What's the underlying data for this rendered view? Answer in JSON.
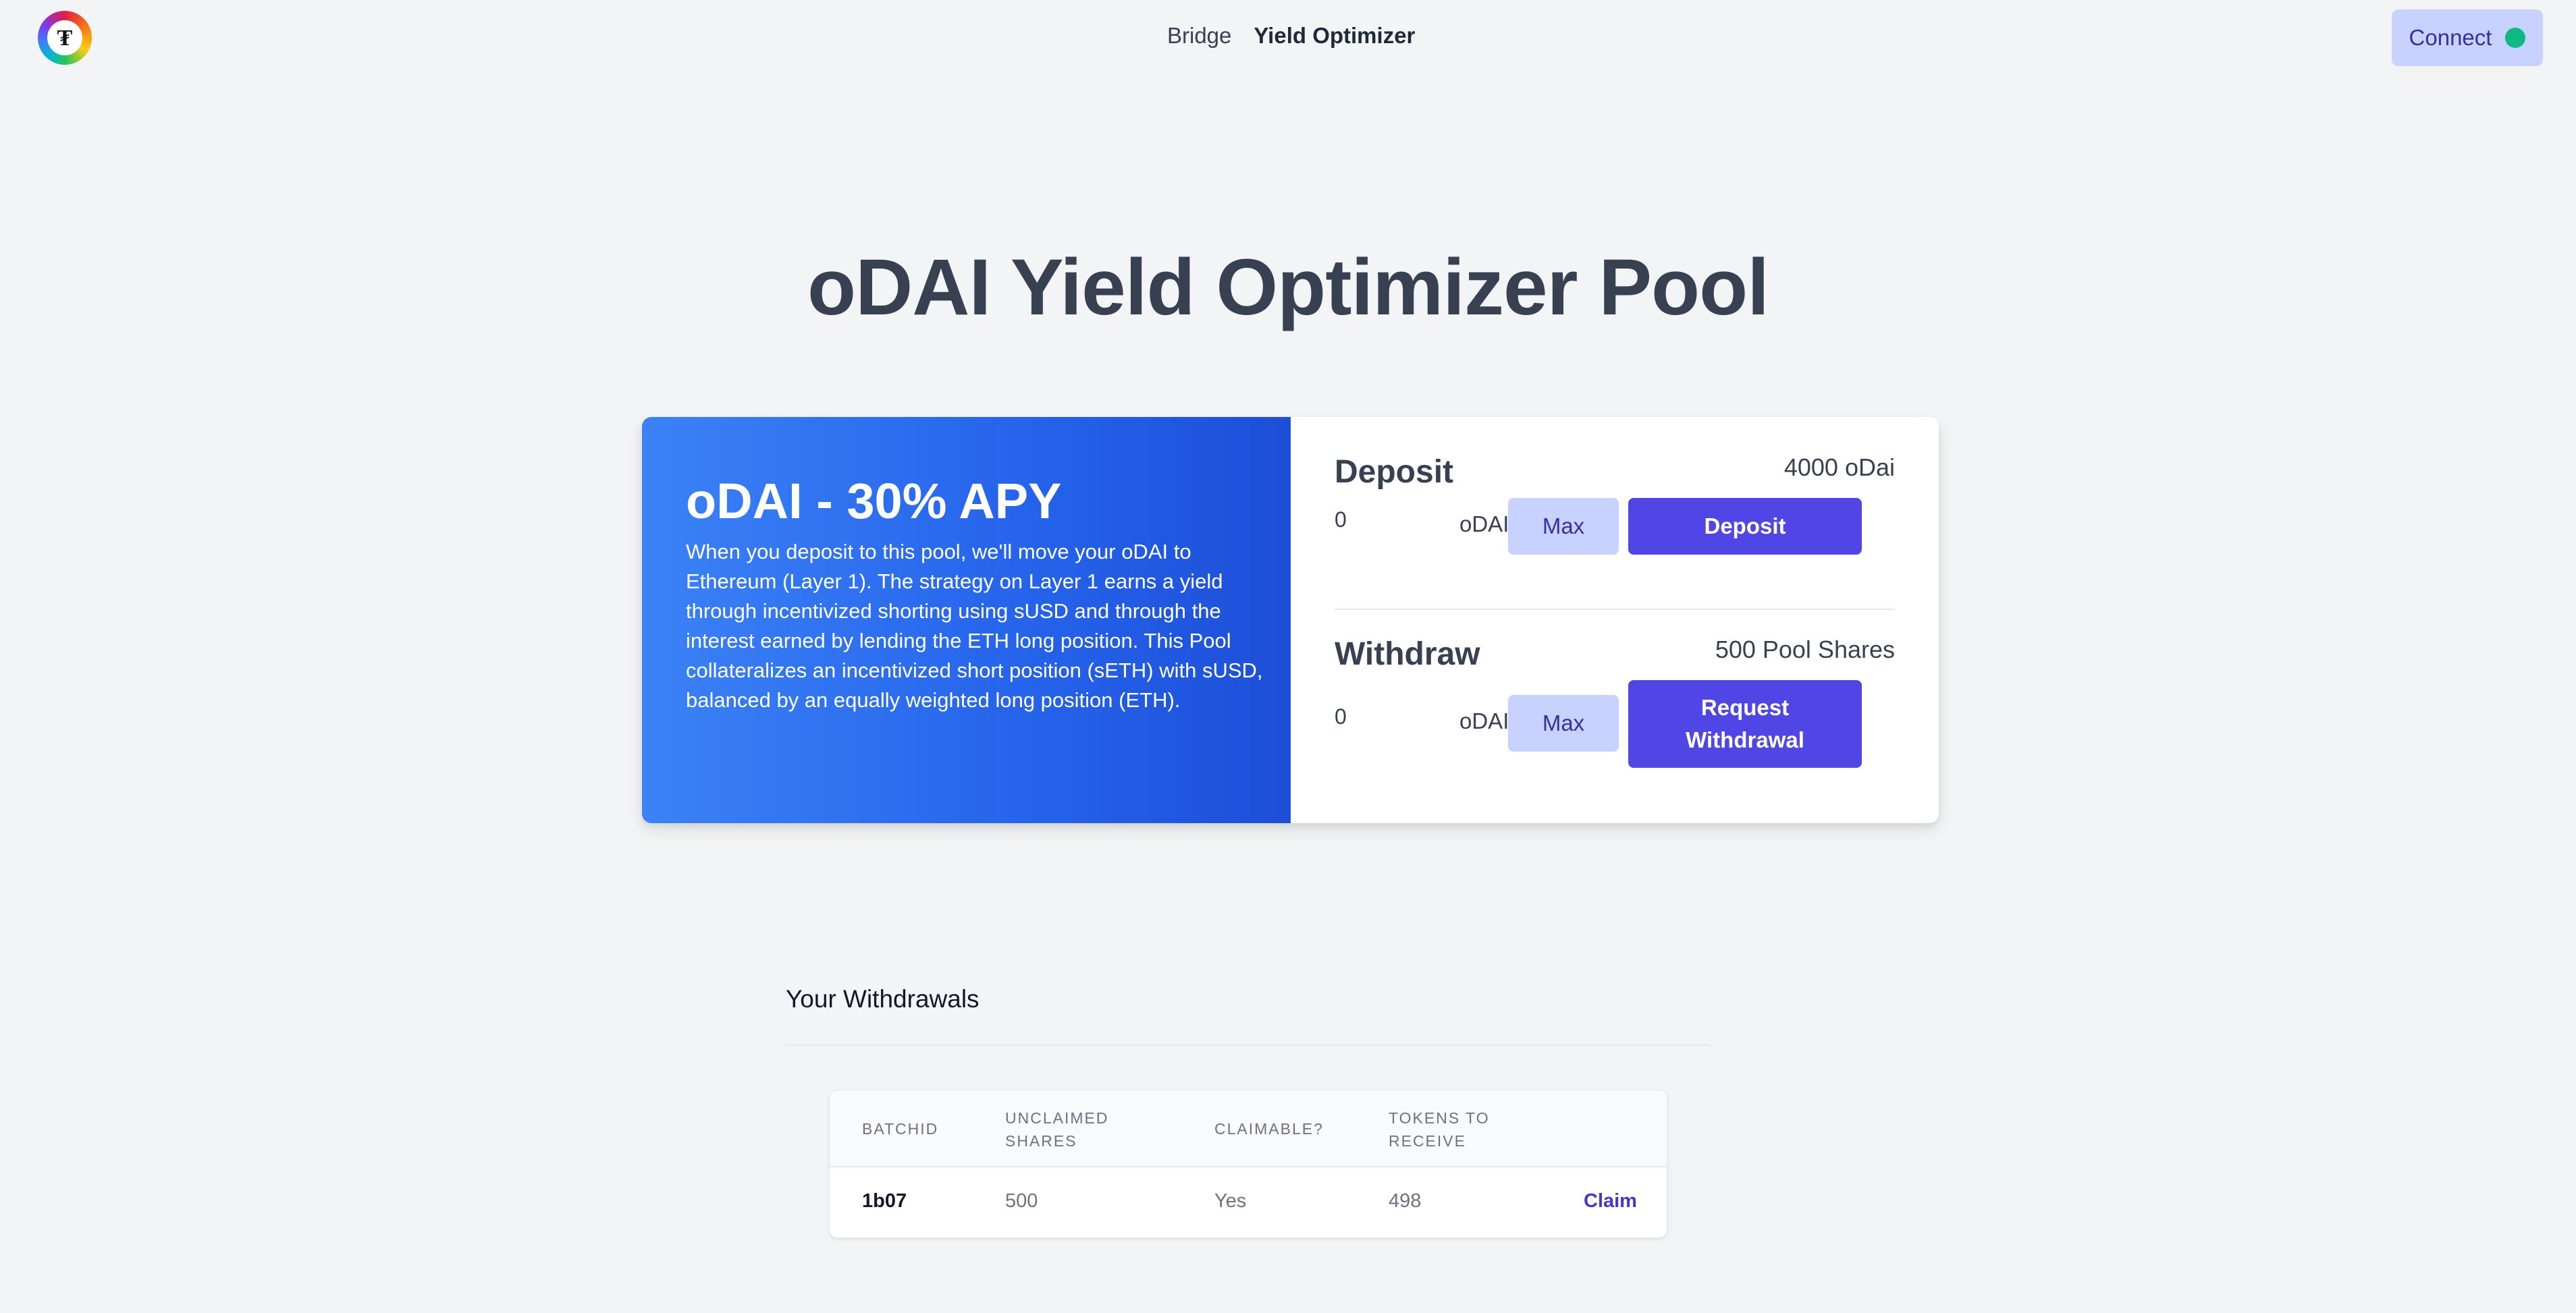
{
  "header": {
    "logo_glyph": "₮",
    "nav": [
      {
        "label": "Bridge",
        "active": false
      },
      {
        "label": "Yield Optimizer",
        "active": true
      }
    ],
    "connect_label": "Connect",
    "connect_status_color": "#10b981"
  },
  "page_title": "oDAI Yield Optimizer Pool",
  "pool": {
    "title": "oDAI - 30% APY",
    "description": "When you deposit to this pool, we'll move your oDAI to Ethereum (Layer 1). The strategy on Layer 1 earns a yield through incentivized shorting using sUSD and through the interest earned by lending the ETH long position. This Pool collateralizes an incentivized short position (sETH) with sUSD, balanced by an equally weighted long position (ETH)."
  },
  "deposit": {
    "title": "Deposit",
    "balance": "4000 oDai",
    "input_value": "0",
    "unit": "oDAI",
    "max_label": "Max",
    "action_label": "Deposit"
  },
  "withdraw": {
    "title": "Withdraw",
    "balance": "500 Pool Shares",
    "input_value": "0",
    "unit": "oDAI",
    "max_label": "Max",
    "action_label": "Request Withdrawal"
  },
  "withdrawals": {
    "title": "Your Withdrawals",
    "columns": [
      "BatchID",
      "Unclaimed Shares",
      "Claimable?",
      "Tokens to Receive"
    ],
    "rows": [
      {
        "batch_id": "1b07",
        "unclaimed_shares": "500",
        "claimable": "Yes",
        "tokens_to_receive": "498",
        "action": "Claim"
      }
    ]
  },
  "colors": {
    "accent": "#4f46e5",
    "accent_light": "#c7d2fe",
    "gradient_start": "#3b82f6",
    "gradient_end": "#1d4ed8",
    "background": "#f3f4f6"
  }
}
